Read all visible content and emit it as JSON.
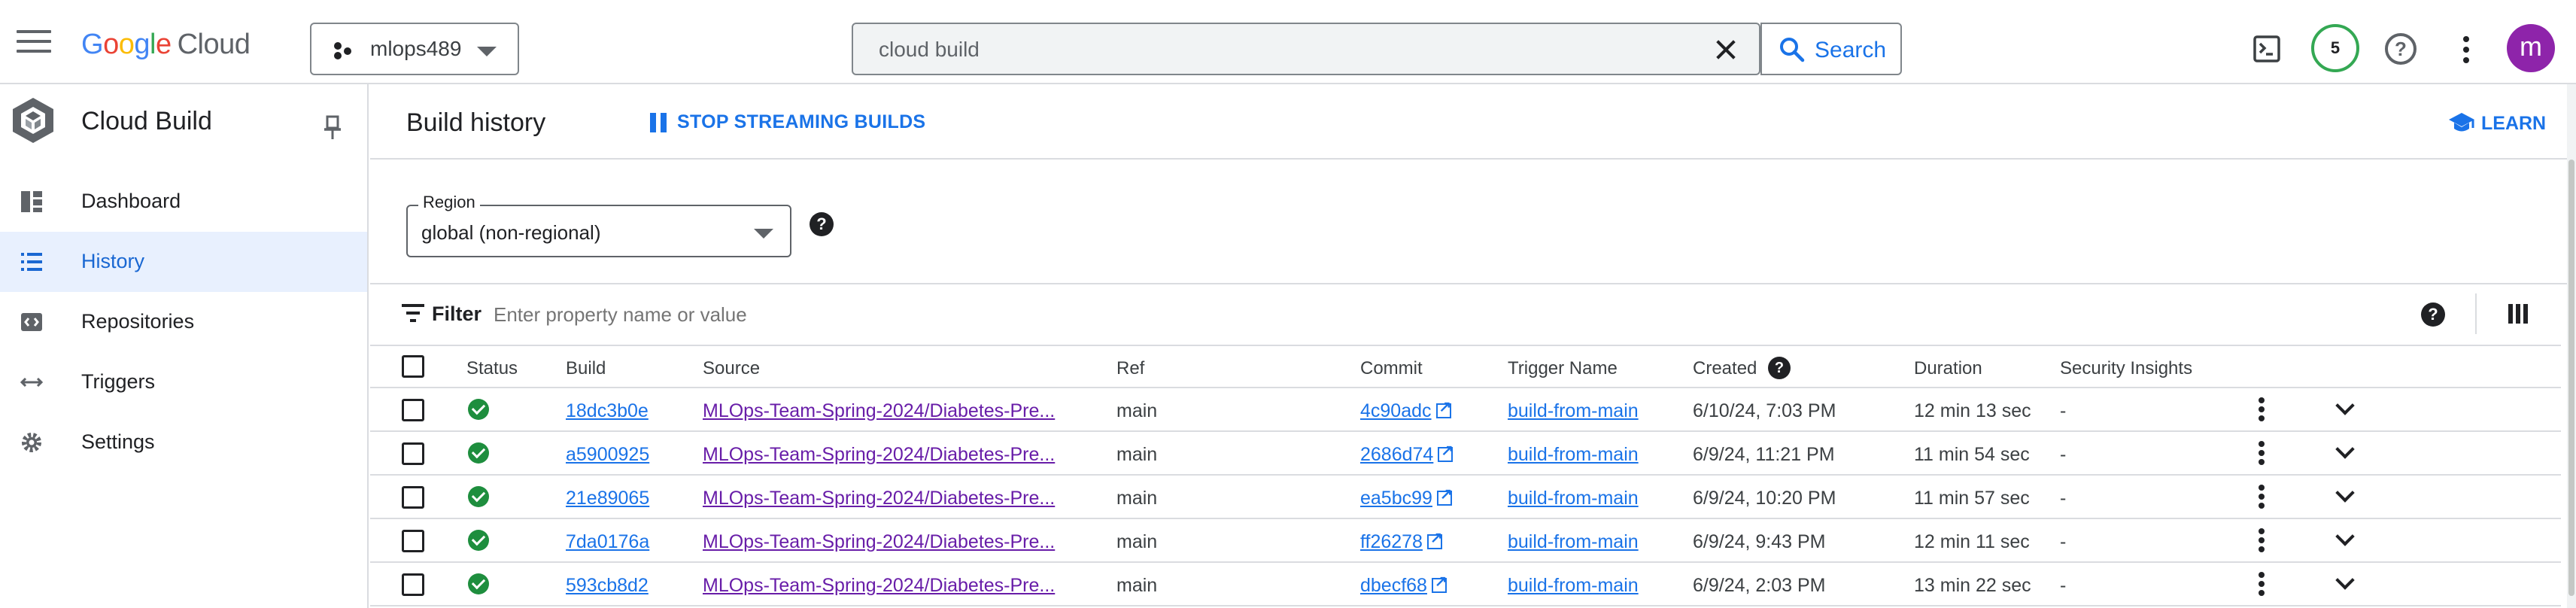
{
  "top_bar": {
    "logo": {
      "letters": [
        "G",
        "o",
        "o",
        "g",
        "l",
        "e"
      ],
      "product": "Cloud"
    },
    "project": "mlops489",
    "search": {
      "value": "cloud build",
      "button_label": "Search"
    },
    "notifications_count": "5",
    "avatar_initial": "m"
  },
  "sidebar": {
    "title": "Cloud Build",
    "items": [
      {
        "label": "Dashboard",
        "icon": "dashboard-icon",
        "active": false
      },
      {
        "label": "History",
        "icon": "list-icon",
        "active": true
      },
      {
        "label": "Repositories",
        "icon": "code-icon",
        "active": false
      },
      {
        "label": "Triggers",
        "icon": "arrows-icon",
        "active": false
      },
      {
        "label": "Settings",
        "icon": "gear-icon",
        "active": false
      }
    ]
  },
  "header": {
    "title": "Build history",
    "stream_label": "STOP STREAMING BUILDS",
    "learn_label": "LEARN"
  },
  "region": {
    "label": "Region",
    "value": "global (non-regional)"
  },
  "filter": {
    "label": "Filter",
    "placeholder": "Enter property name or value"
  },
  "table": {
    "columns": [
      "Status",
      "Build",
      "Source",
      "Ref",
      "Commit",
      "Trigger Name",
      "Created",
      "Duration",
      "Security Insights"
    ],
    "rows": [
      {
        "status": "success",
        "build": "18dc3b0e",
        "source": "MLOps-Team-Spring-2024/Diabetes-Pre...",
        "ref": "main",
        "commit": "4c90adc",
        "trigger": "build-from-main",
        "created": "6/10/24, 7:03 PM",
        "duration": "12 min 13 sec",
        "insights": "-"
      },
      {
        "status": "success",
        "build": "a5900925",
        "source": "MLOps-Team-Spring-2024/Diabetes-Pre...",
        "ref": "main",
        "commit": "2686d74",
        "trigger": "build-from-main",
        "created": "6/9/24, 11:21 PM",
        "duration": "11 min 54 sec",
        "insights": "-"
      },
      {
        "status": "success",
        "build": "21e89065",
        "source": "MLOps-Team-Spring-2024/Diabetes-Pre...",
        "ref": "main",
        "commit": "ea5bc99",
        "trigger": "build-from-main",
        "created": "6/9/24, 10:20 PM",
        "duration": "11 min 57 sec",
        "insights": "-"
      },
      {
        "status": "success",
        "build": "7da0176a",
        "source": "MLOps-Team-Spring-2024/Diabetes-Pre...",
        "ref": "main",
        "commit": "ff26278",
        "trigger": "build-from-main",
        "created": "6/9/24, 9:43 PM",
        "duration": "12 min 11 sec",
        "insights": "-"
      },
      {
        "status": "success",
        "build": "593cb8d2",
        "source": "MLOps-Team-Spring-2024/Diabetes-Pre...",
        "ref": "main",
        "commit": "dbecf68",
        "trigger": "build-from-main",
        "created": "6/9/24, 2:03 PM",
        "duration": "13 min 22 sec",
        "insights": "-"
      }
    ]
  },
  "colors": {
    "accent": "#1a73e8",
    "success": "#1e8e3e",
    "visited_link": "#681da8",
    "avatar": "#8e24aa",
    "active_nav_bg": "#e8f0fe"
  }
}
